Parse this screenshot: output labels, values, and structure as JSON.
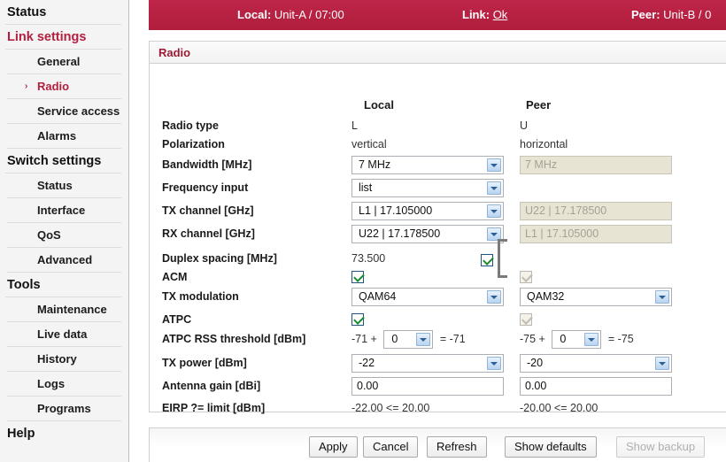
{
  "sidebar": {
    "items": [
      {
        "label": "Status",
        "level": "top",
        "accent": false,
        "active": false
      },
      {
        "label": "Link settings",
        "level": "top",
        "accent": true,
        "active": false
      },
      {
        "label": "General",
        "level": "sub",
        "accent": false,
        "active": false
      },
      {
        "label": "Radio",
        "level": "sub",
        "accent": false,
        "active": true
      },
      {
        "label": "Service access",
        "level": "sub",
        "accent": false,
        "active": false
      },
      {
        "label": "Alarms",
        "level": "sub",
        "accent": false,
        "active": false
      },
      {
        "label": "Switch settings",
        "level": "top",
        "accent": false,
        "active": false
      },
      {
        "label": "Status",
        "level": "sub",
        "accent": false,
        "active": false
      },
      {
        "label": "Interface",
        "level": "sub",
        "accent": false,
        "active": false
      },
      {
        "label": "QoS",
        "level": "sub",
        "accent": false,
        "active": false
      },
      {
        "label": "Advanced",
        "level": "sub",
        "accent": false,
        "active": false
      },
      {
        "label": "Tools",
        "level": "top",
        "accent": false,
        "active": false
      },
      {
        "label": "Maintenance",
        "level": "sub",
        "accent": false,
        "active": false
      },
      {
        "label": "Live data",
        "level": "sub",
        "accent": false,
        "active": false
      },
      {
        "label": "History",
        "level": "sub",
        "accent": false,
        "active": false
      },
      {
        "label": "Logs",
        "level": "sub",
        "accent": false,
        "active": false
      },
      {
        "label": "Programs",
        "level": "sub",
        "accent": false,
        "active": false
      },
      {
        "label": "Help",
        "level": "top",
        "accent": false,
        "active": false
      }
    ],
    "active_marker": "›"
  },
  "topbar": {
    "local_key": "Local:",
    "local_value": "Unit-A / 07:00",
    "link_key": "Link:",
    "link_value": "Ok",
    "peer_key": "Peer:",
    "peer_value": "Unit-B / 0",
    "bg_color": "#b51f3f"
  },
  "panel": {
    "title": "Radio",
    "title_color": "#9b1b33",
    "column_local": "Local",
    "column_peer": "Peer"
  },
  "rows": {
    "radio_type": {
      "label": "Radio type",
      "local": "L",
      "peer": "U"
    },
    "polarization": {
      "label": "Polarization",
      "local": "vertical",
      "peer": "horizontal"
    },
    "bandwidth": {
      "label": "Bandwidth [MHz]",
      "local": "7 MHz",
      "peer": "7 MHz"
    },
    "frequency_input": {
      "label": "Frequency input",
      "local": "list",
      "peer": ""
    },
    "tx_channel": {
      "label": "TX channel [GHz]",
      "local": "L1 | 17.105000",
      "peer": "U22 | 17.178500"
    },
    "rx_channel": {
      "label": "RX channel [GHz]",
      "local": "U22 | 17.178500",
      "peer": "L1 | 17.105000"
    },
    "duplex_spacing": {
      "label": "Duplex spacing [MHz]",
      "local": "73.500",
      "peer": ""
    },
    "acm": {
      "label": "ACM",
      "local": "checked",
      "peer": "checked-disabled"
    },
    "tx_modulation": {
      "label": "TX modulation",
      "local": "QAM64",
      "peer": "QAM32"
    },
    "atpc": {
      "label": "ATPC",
      "local": "checked",
      "peer": "checked-disabled"
    },
    "atpc_rss": {
      "label": "ATPC RSS threshold [dBm]",
      "local_base": "-71 +",
      "local_offset": "0",
      "local_result": "= -71",
      "peer_base": "-75 +",
      "peer_offset": "0",
      "peer_result": "= -75"
    },
    "tx_power": {
      "label": "TX power [dBm]",
      "local": "-22",
      "peer": "-20"
    },
    "antenna_gain": {
      "label": "Antenna gain [dBi]",
      "local": "0.00",
      "peer": "0.00"
    },
    "eirp": {
      "label": "EIRP ?= limit [dBm]",
      "local": "-22.00 <= 20.00",
      "peer": "-20.00 <= 20.00"
    }
  },
  "buttons": {
    "apply": "Apply",
    "cancel": "Cancel",
    "refresh": "Refresh",
    "show_defaults": "Show defaults",
    "show_backup": "Show backup"
  }
}
